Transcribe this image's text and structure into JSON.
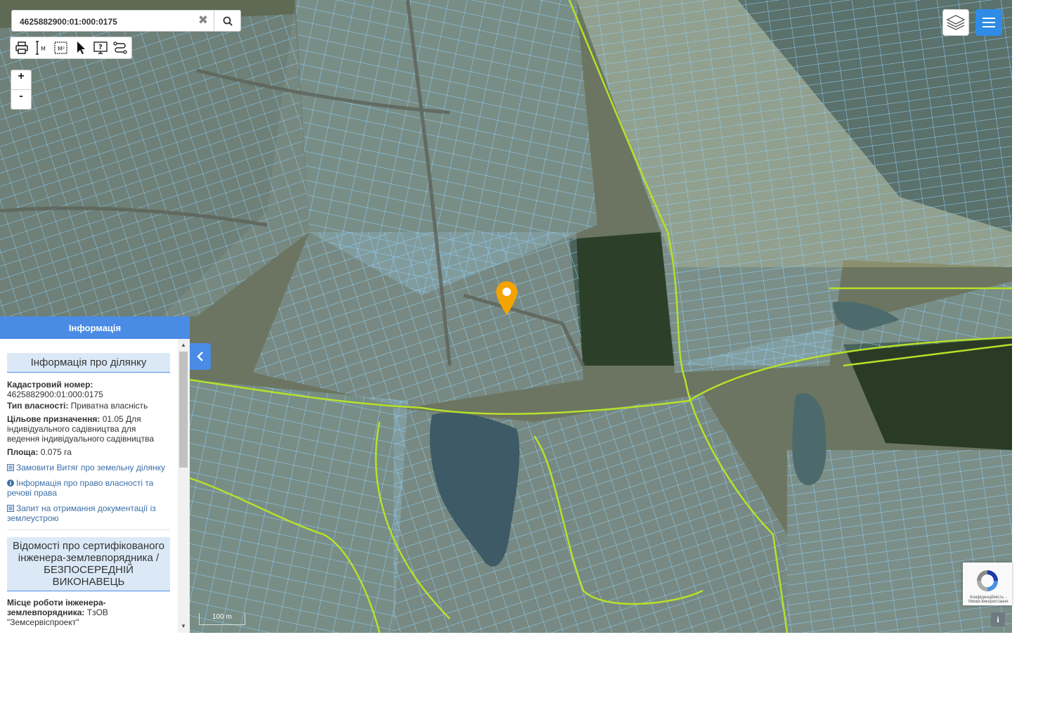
{
  "search": {
    "value": "4625882900:01:000:0175",
    "clear_glyph": "✖"
  },
  "toolbar": {
    "icons": [
      "print-icon",
      "measure-distance-icon",
      "measure-area-icon",
      "pointer-icon",
      "info-screen-icon",
      "route-icon"
    ]
  },
  "zoom": {
    "in_label": "+",
    "out_label": "-"
  },
  "scale": {
    "label": "100 m"
  },
  "recaptcha": {
    "text": "Конфіденційність - Умови використання"
  },
  "info_button": {
    "label": "i"
  },
  "panel": {
    "header": "Інформація",
    "section1_title": "Інформація про ділянку",
    "cadastral_label": "Кадастровий номер:",
    "cadastral_value": "4625882900:01:000:0175",
    "ownership_label": "Тип власності:",
    "ownership_value": "Приватна власність",
    "purpose_label": "Цільове призначення:",
    "purpose_value": "01.05 Для індивідуального садівництва для ведення індивідуального садівництва",
    "area_label": "Площа:",
    "area_value": "0.075 га",
    "link1": "Замовити Витяг про земельну ділянку",
    "link2": "Інформація про право власності та речові права",
    "link3": "Запит на отримання документації із землеустрою",
    "section2_title": "Відомості про сертифікованого інженера-землевпорядника / БЕЗПОСЕРЕДНІЙ ВИКОНАВЕЦЬ",
    "workplace_label": "Місце роботи інженера-землевпорядника:",
    "workplace_value": "ТзОВ \"Земсервіспроект\""
  },
  "colors": {
    "accent": "#4a8be6",
    "parcel_outline": "#8fd3ff",
    "boundary": "#b6e12a",
    "marker": "#f5a300"
  }
}
